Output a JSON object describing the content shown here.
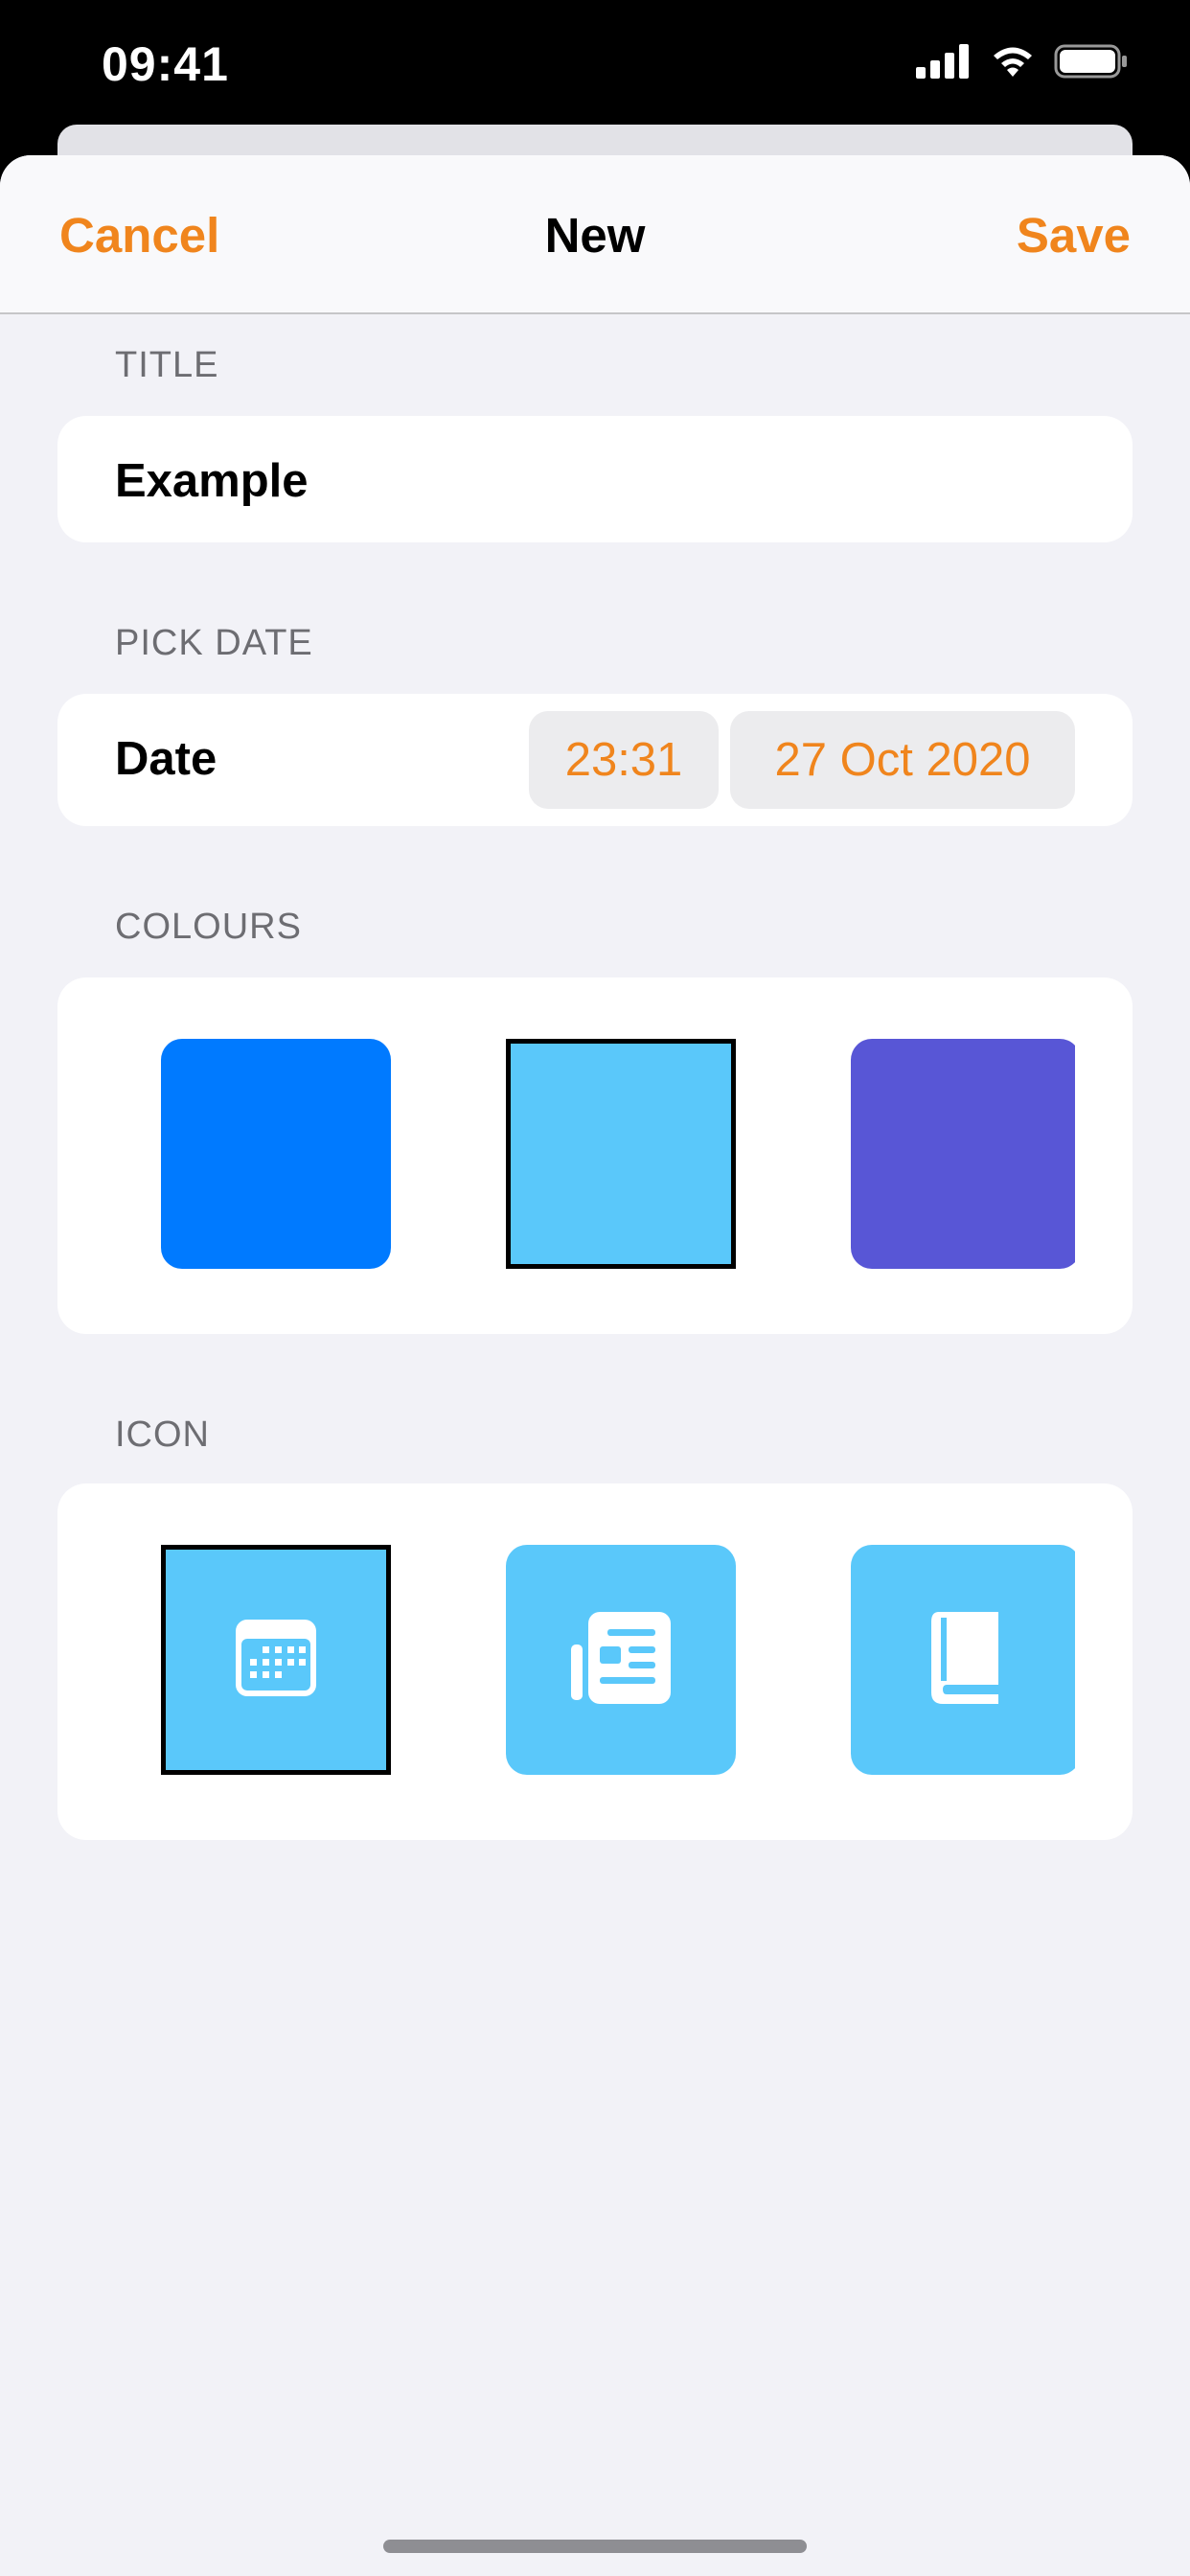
{
  "status_bar": {
    "time": "09:41",
    "icons": [
      "signal-icon",
      "wifi-icon",
      "battery-icon"
    ]
  },
  "nav": {
    "cancel_label": "Cancel",
    "title": "New",
    "save_label": "Save"
  },
  "sections": {
    "title_header": "TITLE",
    "title_value": "Example",
    "date_header": "PICK DATE",
    "date_label": "Date",
    "time_value": "23:31",
    "date_value": "27 Oct 2020",
    "colours_header": "COLOURS",
    "icon_header": "ICON"
  },
  "colours": [
    {
      "hex": "#007aff",
      "selected": false
    },
    {
      "hex": "#5ac8fa",
      "selected": true
    },
    {
      "hex": "#5856d6",
      "selected": false
    }
  ],
  "icons": [
    {
      "name": "calendar-icon",
      "selected": true
    },
    {
      "name": "newspaper-icon",
      "selected": false
    },
    {
      "name": "book-icon",
      "selected": false
    }
  ],
  "theme": {
    "accent": "#f0851d",
    "tile_color": "#5ac8fa",
    "background": "#f2f2f7"
  }
}
